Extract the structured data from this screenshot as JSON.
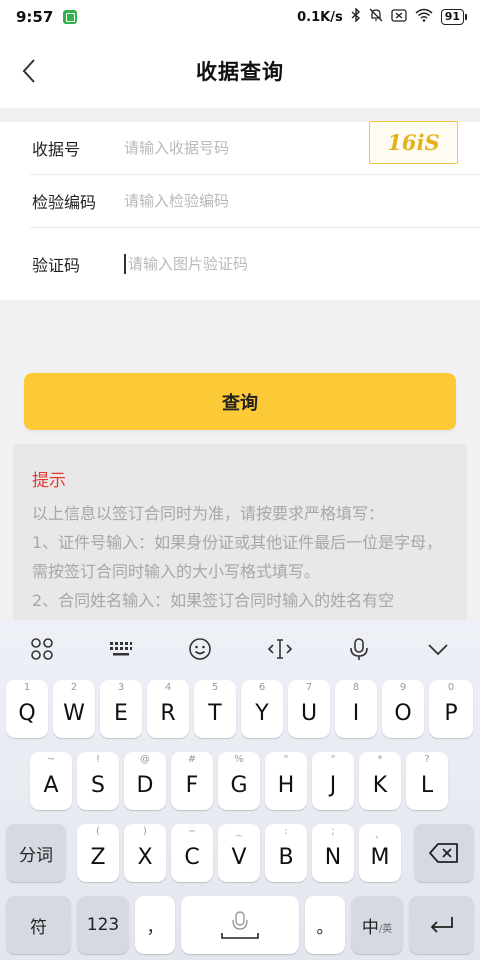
{
  "status_bar": {
    "time": "9:57",
    "net_speed": "0.1K/s",
    "battery": "91"
  },
  "nav": {
    "title": "收据查询"
  },
  "form": {
    "receipt_no": {
      "label": "收据号",
      "placeholder": "请输入收据号码",
      "value": ""
    },
    "check_code": {
      "label": "检验编码",
      "placeholder": "请输入检验编码",
      "value": ""
    },
    "captcha": {
      "label": "验证码",
      "placeholder": "请输入图片验证码",
      "value": "",
      "image_text": "16iS"
    }
  },
  "query_button": {
    "label": "查询"
  },
  "tips": {
    "title": "提示",
    "lines": [
      "以上信息以签订合同时为准，请按要求严格填写：",
      "1、证件号输入：如果身份证或其他证件最后一位是字母，需按签订合同时输入的大小写格式填写。",
      "2、合同姓名输入：如果签订合同时输入的姓名有空"
    ]
  },
  "keyboard": {
    "row1": [
      {
        "k": "Q",
        "s": "1"
      },
      {
        "k": "W",
        "s": "2"
      },
      {
        "k": "E",
        "s": "3"
      },
      {
        "k": "R",
        "s": "4"
      },
      {
        "k": "T",
        "s": "5"
      },
      {
        "k": "Y",
        "s": "6"
      },
      {
        "k": "U",
        "s": "7"
      },
      {
        "k": "I",
        "s": "8"
      },
      {
        "k": "O",
        "s": "9"
      },
      {
        "k": "P",
        "s": "0"
      }
    ],
    "row2": [
      {
        "k": "A",
        "s": "~"
      },
      {
        "k": "S",
        "s": "!"
      },
      {
        "k": "D",
        "s": "@"
      },
      {
        "k": "F",
        "s": "#"
      },
      {
        "k": "G",
        "s": "%"
      },
      {
        "k": "H",
        "s": "\""
      },
      {
        "k": "J",
        "s": "\""
      },
      {
        "k": "K",
        "s": "*"
      },
      {
        "k": "L",
        "s": "?"
      }
    ],
    "row3": [
      {
        "k": "Z",
        "s": "("
      },
      {
        "k": "X",
        "s": ")"
      },
      {
        "k": "C",
        "s": "−"
      },
      {
        "k": "V",
        "s": "_"
      },
      {
        "k": "B",
        "s": ":"
      },
      {
        "k": "N",
        "s": ";"
      },
      {
        "k": "M",
        "s": "、"
      }
    ],
    "fenci_label": "分词",
    "symbol_label": "符",
    "num_label": "123",
    "comma_label": "，",
    "period_label": "。",
    "lang_label": "中",
    "lang_sub": "/英"
  },
  "colors": {
    "accent": "#fcca36",
    "tip_title": "#e8382f",
    "captcha_text": "#e4b21c"
  }
}
